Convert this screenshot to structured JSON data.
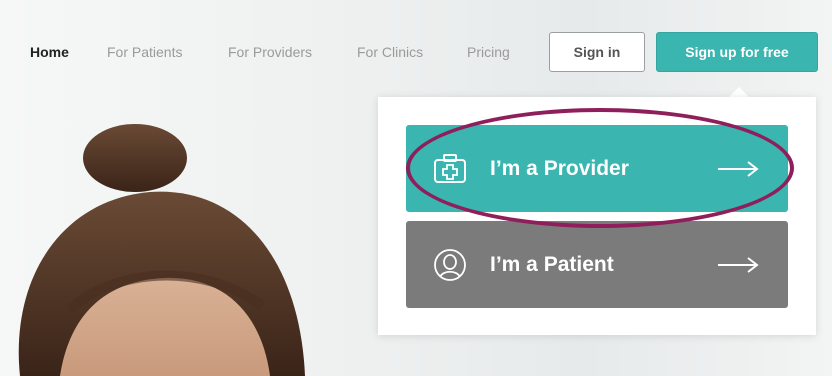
{
  "nav": {
    "links": [
      "Home",
      "For Patients",
      "For Providers",
      "For Clinics",
      "Pricing"
    ],
    "signin_label": "Sign in",
    "signup_label": "Sign up for free"
  },
  "dropdown": {
    "provider_label": "I’m a Provider",
    "patient_label": "I’m a Patient"
  },
  "colors": {
    "accent": "#3ab5b0",
    "patient_option": "#7b7b7b",
    "highlight_ring": "#8e1f5b"
  },
  "icons": [
    "medical-bag-icon",
    "person-avatar-icon",
    "arrow-right-icon"
  ]
}
